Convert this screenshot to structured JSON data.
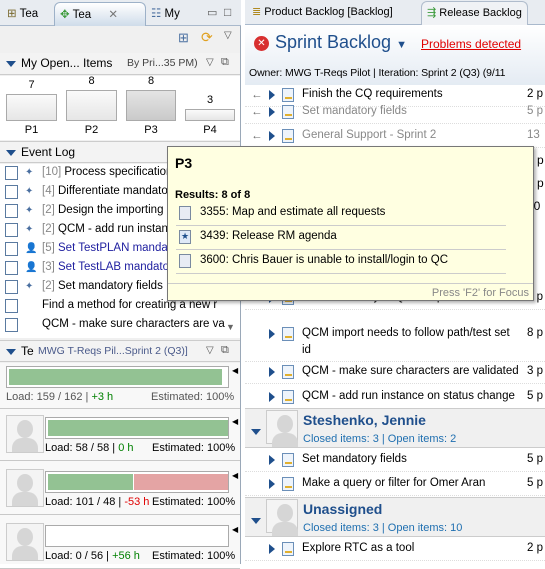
{
  "left_tabs": [
    {
      "label": "Tea",
      "icon": "team-org-icon"
    },
    {
      "label": "Tea",
      "icon": "team-central-icon",
      "active": true
    },
    {
      "label": "My",
      "icon": "my-work-icon"
    }
  ],
  "my_open_items": {
    "title": "My Open... Items",
    "grouping": "By Pri...35 PM)"
  },
  "chart_data": {
    "type": "bar",
    "categories": [
      "P1",
      "P2",
      "P3",
      "P4"
    ],
    "values": [
      7,
      8,
      8,
      3
    ],
    "highlighted": "P3"
  },
  "event_log": {
    "title": "Event Log",
    "items": [
      {
        "count": "[10]",
        "text": "Process specification",
        "style": "normal"
      },
      {
        "count": "[4]",
        "text": "Differentiate mandatory",
        "style": "normal"
      },
      {
        "count": "[2]",
        "text": "Design the importing",
        "style": "normal"
      },
      {
        "count": "[2]",
        "text": "QCM - add run instance",
        "style": "normal"
      },
      {
        "count": "[5]",
        "text": "Set TestPLAN mandatory",
        "style": "blue"
      },
      {
        "count": "[3]",
        "text": "Set TestLAB mandatory",
        "style": "blue"
      },
      {
        "count": "[2]",
        "text": "Set mandatory fields",
        "style": "normal"
      },
      {
        "count": "",
        "text": "Find a method for creating a new r",
        "style": "normal"
      },
      {
        "count": "",
        "text": "QCM - make sure characters are va",
        "style": "normal"
      }
    ]
  },
  "team_load": {
    "title": "Te",
    "scope": "MWG T-Reqs Pil...Sprint 2 (Q3)]",
    "total": {
      "load": "Load: 159 / 162 | ",
      "delta": "+3 h",
      "estimated": "Estimated: 100%",
      "fill_percent": 98
    },
    "members": [
      {
        "load": "Load: 58 / 58 | ",
        "delta": "0 h",
        "delta_color": "#008000",
        "estimated": "Estimated: 100%",
        "green_percent": 100,
        "red_percent": 0
      },
      {
        "load": "Load: 101 / 48 | ",
        "delta": "-53 h",
        "delta_color": "#e00000",
        "estimated": "Estimated: 100%",
        "green_percent": 47,
        "red_percent": 53
      },
      {
        "load": "Load: 0 / 56 | ",
        "delta": "+56 h",
        "delta_color": "#008000",
        "estimated": "Estimated: 100%",
        "green_percent": 0,
        "red_percent": 0
      }
    ]
  },
  "right_tabs": [
    {
      "label": "Product Backlog [Backlog]"
    },
    {
      "label": "Release Backlog"
    }
  ],
  "editor": {
    "title": "Sprint Backlog",
    "problems": "Problems detected",
    "owner_line": "Owner: MWG T-Reqs Pilot | Iteration: Sprint 2 (Q3) (9/11"
  },
  "rows_top": [
    {
      "text": "Finish the CQ requirements",
      "pts": "2 p",
      "gray": false
    },
    {
      "text": "Set mandatory fields",
      "pts": "5 p",
      "gray": true
    },
    {
      "text": "General Support - Sprint 2",
      "pts": "13",
      "gray": true
    }
  ],
  "hidden_pts": [
    "5 p",
    "3 p",
    "20"
  ],
  "rows_mid": [
    {
      "text": "non-mandatory in QCM exports",
      "pts": "1 p"
    },
    {
      "text": "QCM import needs to follow path/test set",
      "text2": "id",
      "pts": "8 p"
    },
    {
      "text": "QCM - make sure characters are validated",
      "pts": "3 p"
    },
    {
      "text": "QCM - add run instance on status change",
      "pts": "5 p"
    }
  ],
  "groups": [
    {
      "name": "Steshenko, Jennie",
      "sub": "Closed items: 3 | Open items: 2",
      "rows": [
        {
          "text": "Set mandatory fields",
          "pts": "5 p"
        },
        {
          "text": "Make a query or filter for Omer Aran",
          "pts": "5 p"
        }
      ]
    },
    {
      "name": "Unassigned",
      "sub": "Closed items: 3 | Open items: 10",
      "rows": [
        {
          "text": "Explore RTC as a tool",
          "pts": "2 p"
        }
      ]
    }
  ],
  "tooltip": {
    "title": "P3",
    "results": "Results: 8 of 8",
    "items": [
      "3355: Map and estimate all requests",
      "3439: Release RM agenda",
      "3600: Chris Bauer is unable to install/login to QC"
    ],
    "footer": "Press 'F2' for Focus"
  },
  "colors": {
    "accent": "#1f4f8c",
    "error": "#e00000",
    "load_green": "#93c293",
    "load_red": "#e4a4a4",
    "tooltip_bg": "#ffffe1"
  }
}
